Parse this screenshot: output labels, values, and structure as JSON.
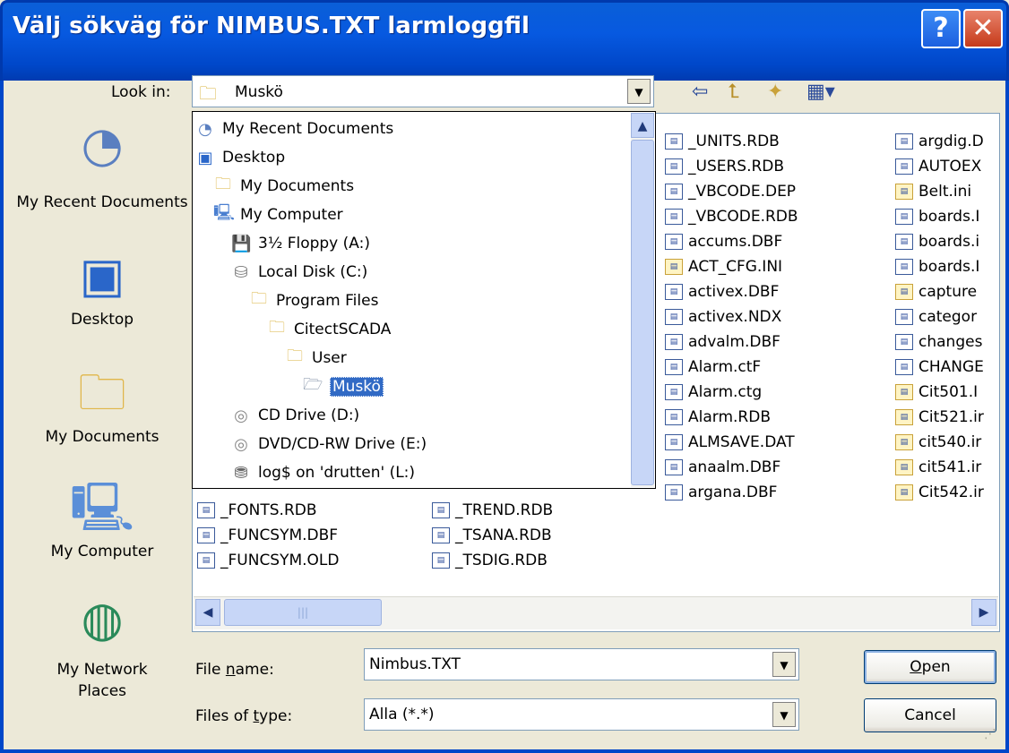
{
  "window": {
    "title": "Välj sökväg för NIMBUS.TXT larmloggfil",
    "help_label": "?",
    "close_label": "✕"
  },
  "lookin": {
    "label": "Look in:",
    "value": "Muskö"
  },
  "places": [
    {
      "label": "My Recent Documents",
      "icon": "recent-documents-icon"
    },
    {
      "label": "Desktop",
      "icon": "desktop-icon"
    },
    {
      "label": "My Documents",
      "icon": "my-documents-icon"
    },
    {
      "label": "My Computer",
      "icon": "my-computer-icon"
    },
    {
      "label": "My Network Places",
      "icon": "network-places-icon"
    }
  ],
  "popup": {
    "items": [
      {
        "label": "My Recent Documents",
        "icon": "recent-documents-icon"
      },
      {
        "label": "Desktop",
        "icon": "desktop-icon"
      },
      {
        "label": "My Documents",
        "icon": "my-documents-icon"
      },
      {
        "label": "My Computer",
        "icon": "my-computer-icon"
      },
      {
        "label": "3½ Floppy (A:)",
        "icon": "floppy-icon"
      },
      {
        "label": "Local Disk (C:)",
        "icon": "disk-icon"
      },
      {
        "label": "Program Files",
        "icon": "folder-icon"
      },
      {
        "label": "CitectSCADA",
        "icon": "folder-icon"
      },
      {
        "label": "User",
        "icon": "folder-icon"
      },
      {
        "label": "Muskö",
        "icon": "folder-open-icon"
      },
      {
        "label": "CD Drive (D:)",
        "icon": "cd-icon"
      },
      {
        "label": "DVD/CD-RW Drive (E:)",
        "icon": "cd-icon"
      },
      {
        "label": "log$ on 'drutten' (L:)",
        "icon": "network-drive-icon"
      }
    ]
  },
  "files": {
    "col1": [
      "_FONTS.RDB",
      "_FUNCSYM.DBF",
      "_FUNCSYM.OLD"
    ],
    "col2": [
      "_TREND.RDB",
      "_TSANA.RDB",
      "_TSDIG.RDB"
    ],
    "col3": [
      "_UNITS.RDB",
      "_USERS.RDB",
      "_VBCODE.DEP",
      "_VBCODE.RDB",
      "accums.DBF",
      "ACT_CFG.INI",
      "activex.DBF",
      "activex.NDX",
      "advalm.DBF",
      "Alarm.ctF",
      "Alarm.ctg",
      "Alarm.RDB",
      "ALMSAVE.DAT",
      "anaalm.DBF",
      "argana.DBF"
    ],
    "col4": [
      "argdig.D",
      "AUTOEX",
      "Belt.ini",
      "boards.I",
      "boards.i",
      "boards.I",
      "capture",
      "categor",
      "changes",
      "CHANGE",
      "Cit501.I",
      "Cit521.ir",
      "cit540.ir",
      "cit541.ir",
      "Cit542.ir"
    ]
  },
  "bottom": {
    "filename_label": "File name:",
    "filename_value": "Nimbus.TXT",
    "filetype_label": "Files of type:",
    "filetype_value": "Alla (*.*)",
    "open_label": "Open",
    "cancel_label": "Cancel"
  }
}
